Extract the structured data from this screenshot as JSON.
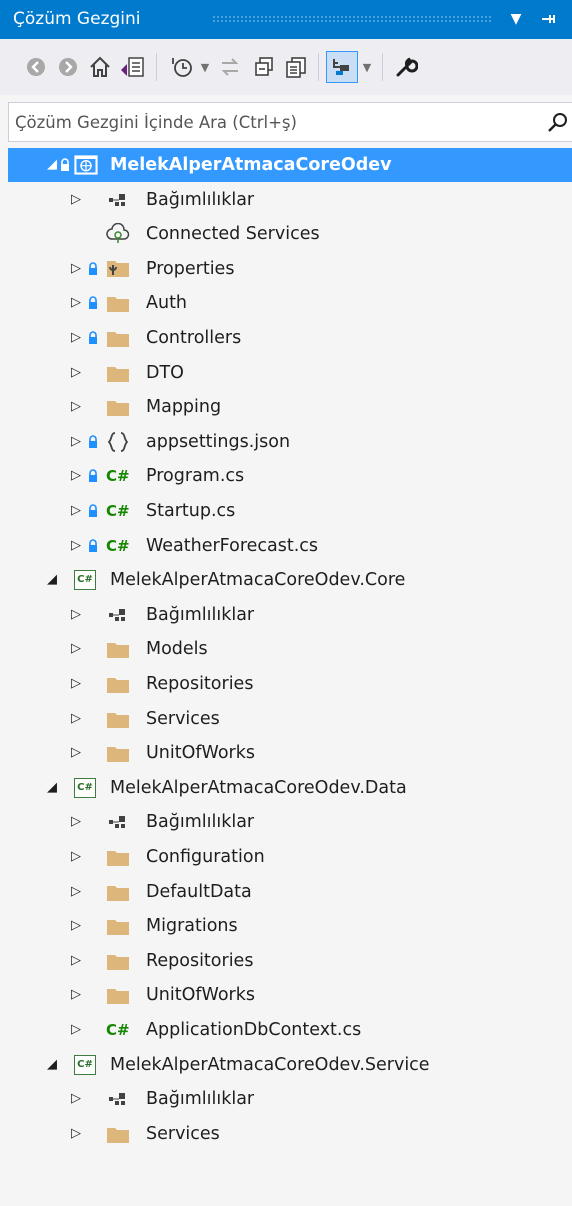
{
  "window": {
    "title": "Çözüm Gezgini",
    "dropdown_icon": "chevron-down-icon",
    "pin_icon": "pin-icon"
  },
  "toolbar": {
    "buttons": [
      {
        "name": "back-button",
        "icon": "back-icon"
      },
      {
        "name": "forward-button",
        "icon": "forward-icon"
      },
      {
        "name": "home-button",
        "icon": "home-icon"
      },
      {
        "name": "switch-views-button",
        "icon": "switch-views-icon"
      },
      {
        "name": "pending-changes-filter-button",
        "icon": "clock-icon"
      },
      {
        "name": "sync-with-active-document-button",
        "icon": "sync-icon"
      },
      {
        "name": "collapse-all-button",
        "icon": "collapse-all-icon"
      },
      {
        "name": "show-all-files-button",
        "icon": "show-all-files-icon"
      },
      {
        "name": "preview-selected-items-button",
        "icon": "preview-icon"
      },
      {
        "name": "properties-button",
        "icon": "wrench-icon"
      }
    ]
  },
  "search": {
    "placeholder": "Çözüm Gezgini İçinde Ara (Ctrl+ş)",
    "icon": "search-icon"
  },
  "colors": {
    "accent": "#007acc",
    "selection": "#3399ff",
    "folder": "#dcb67a",
    "csharp": "#178600",
    "lock": "#1e90ff"
  },
  "tree": [
    {
      "label": "MelekAlperAtmacaCoreOdev",
      "type": "web-project",
      "arrow": "expanded",
      "lock": true,
      "level": 0,
      "selected": true
    },
    {
      "label": "Bağımlılıklar",
      "type": "dependencies",
      "arrow": "collapsed",
      "lock": false,
      "level": 1
    },
    {
      "label": "Connected Services",
      "type": "connected-services",
      "arrow": "none",
      "lock": false,
      "level": 1
    },
    {
      "label": "Properties",
      "type": "properties",
      "arrow": "collapsed",
      "lock": true,
      "level": 1
    },
    {
      "label": "Auth",
      "type": "folder",
      "arrow": "collapsed",
      "lock": true,
      "level": 1
    },
    {
      "label": "Controllers",
      "type": "folder",
      "arrow": "collapsed",
      "lock": true,
      "level": 1
    },
    {
      "label": "DTO",
      "type": "folder",
      "arrow": "collapsed",
      "lock": false,
      "level": 1
    },
    {
      "label": "Mapping",
      "type": "folder",
      "arrow": "collapsed",
      "lock": false,
      "level": 1
    },
    {
      "label": "appsettings.json",
      "type": "json",
      "arrow": "collapsed",
      "lock": true,
      "level": 1
    },
    {
      "label": "Program.cs",
      "type": "csharp",
      "arrow": "collapsed",
      "lock": true,
      "level": 1
    },
    {
      "label": "Startup.cs",
      "type": "csharp",
      "arrow": "collapsed",
      "lock": true,
      "level": 1
    },
    {
      "label": "WeatherForecast.cs",
      "type": "csharp",
      "arrow": "collapsed",
      "lock": true,
      "level": 1
    },
    {
      "label": "MelekAlperAtmacaCoreOdev.Core",
      "type": "cs-project",
      "arrow": "expanded",
      "lock": false,
      "level": 0
    },
    {
      "label": "Bağımlılıklar",
      "type": "dependencies",
      "arrow": "collapsed",
      "lock": false,
      "level": 1
    },
    {
      "label": "Models",
      "type": "folder",
      "arrow": "collapsed",
      "lock": false,
      "level": 1
    },
    {
      "label": "Repositories",
      "type": "folder",
      "arrow": "collapsed",
      "lock": false,
      "level": 1
    },
    {
      "label": "Services",
      "type": "folder",
      "arrow": "collapsed",
      "lock": false,
      "level": 1
    },
    {
      "label": "UnitOfWorks",
      "type": "folder",
      "arrow": "collapsed",
      "lock": false,
      "level": 1
    },
    {
      "label": "MelekAlperAtmacaCoreOdev.Data",
      "type": "cs-project",
      "arrow": "expanded",
      "lock": false,
      "level": 0
    },
    {
      "label": "Bağımlılıklar",
      "type": "dependencies",
      "arrow": "collapsed",
      "lock": false,
      "level": 1
    },
    {
      "label": "Configuration",
      "type": "folder",
      "arrow": "collapsed",
      "lock": false,
      "level": 1
    },
    {
      "label": "DefaultData",
      "type": "folder",
      "arrow": "collapsed",
      "lock": false,
      "level": 1
    },
    {
      "label": "Migrations",
      "type": "folder",
      "arrow": "collapsed",
      "lock": false,
      "level": 1
    },
    {
      "label": "Repositories",
      "type": "folder",
      "arrow": "collapsed",
      "lock": false,
      "level": 1
    },
    {
      "label": "UnitOfWorks",
      "type": "folder",
      "arrow": "collapsed",
      "lock": false,
      "level": 1
    },
    {
      "label": "ApplicationDbContext.cs",
      "type": "csharp",
      "arrow": "collapsed",
      "lock": false,
      "level": 1
    },
    {
      "label": "MelekAlperAtmacaCoreOdev.Service",
      "type": "cs-project",
      "arrow": "expanded",
      "lock": false,
      "level": 0
    },
    {
      "label": "Bağımlılıklar",
      "type": "dependencies",
      "arrow": "collapsed",
      "lock": false,
      "level": 1
    },
    {
      "label": "Services",
      "type": "folder",
      "arrow": "collapsed",
      "lock": false,
      "level": 1
    }
  ]
}
